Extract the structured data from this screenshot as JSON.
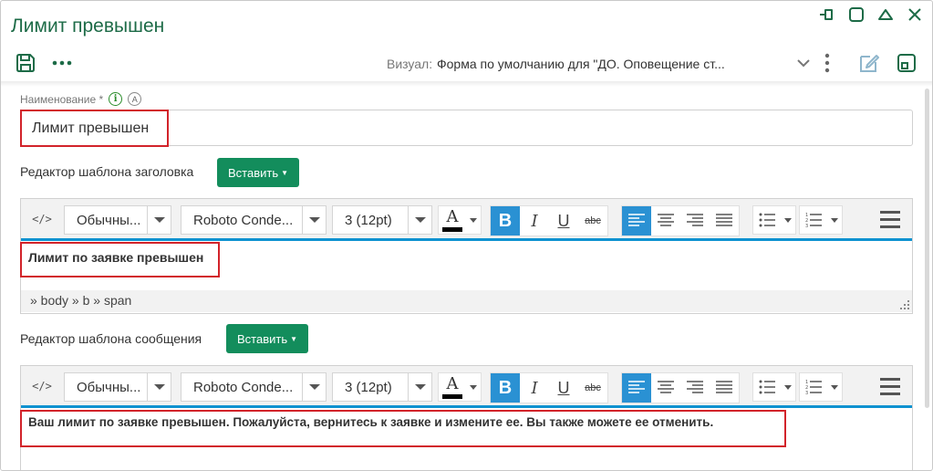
{
  "window": {
    "title": "Лимит превышен"
  },
  "toolbar": {
    "visual_label": "Визуал:",
    "visual_value": "Форма по умолчанию для \"ДО. Оповещение ст..."
  },
  "name_field": {
    "label": "Наименование *",
    "info_icon": "i",
    "auto_icon": "A",
    "value": "Лимит превышен"
  },
  "header_template": {
    "label": "Редактор шаблона заголовка",
    "insert_label": "Вставить",
    "toolbar": {
      "source_label": "</>",
      "style_value": "Обычны...",
      "font_value": "Roboto Conde...",
      "size_value": "3 (12pt)"
    },
    "content": "Лимит по заявке превышен",
    "path": "» body » b » span"
  },
  "message_template": {
    "label": "Редактор шаблона сообщения",
    "insert_label": "Вставить",
    "toolbar": {
      "source_label": "</>",
      "style_value": "Обычны...",
      "font_value": "Roboto Conde...",
      "size_value": "3 (12pt)"
    },
    "content": "Ваш лимит по заявке превышен. Пожалуйста, вернитесь к заявке и измените ее. Вы также можете ее отменить."
  },
  "format_buttons": {
    "bold": "B",
    "italic": "I",
    "underline": "U",
    "strike": "abc",
    "font_color": "A"
  },
  "colors": {
    "title_green": "#1d6b47",
    "button_green": "#138d5c",
    "accent_blue": "#2a91d3",
    "highlight_red": "#d2232a"
  },
  "icons": [
    "pin-icon",
    "maximize-icon",
    "collapse-icon",
    "close-icon",
    "save-icon",
    "more-horizontal-icon",
    "chevron-down-icon",
    "kebab-icon",
    "edit-icon",
    "layout-icon"
  ]
}
